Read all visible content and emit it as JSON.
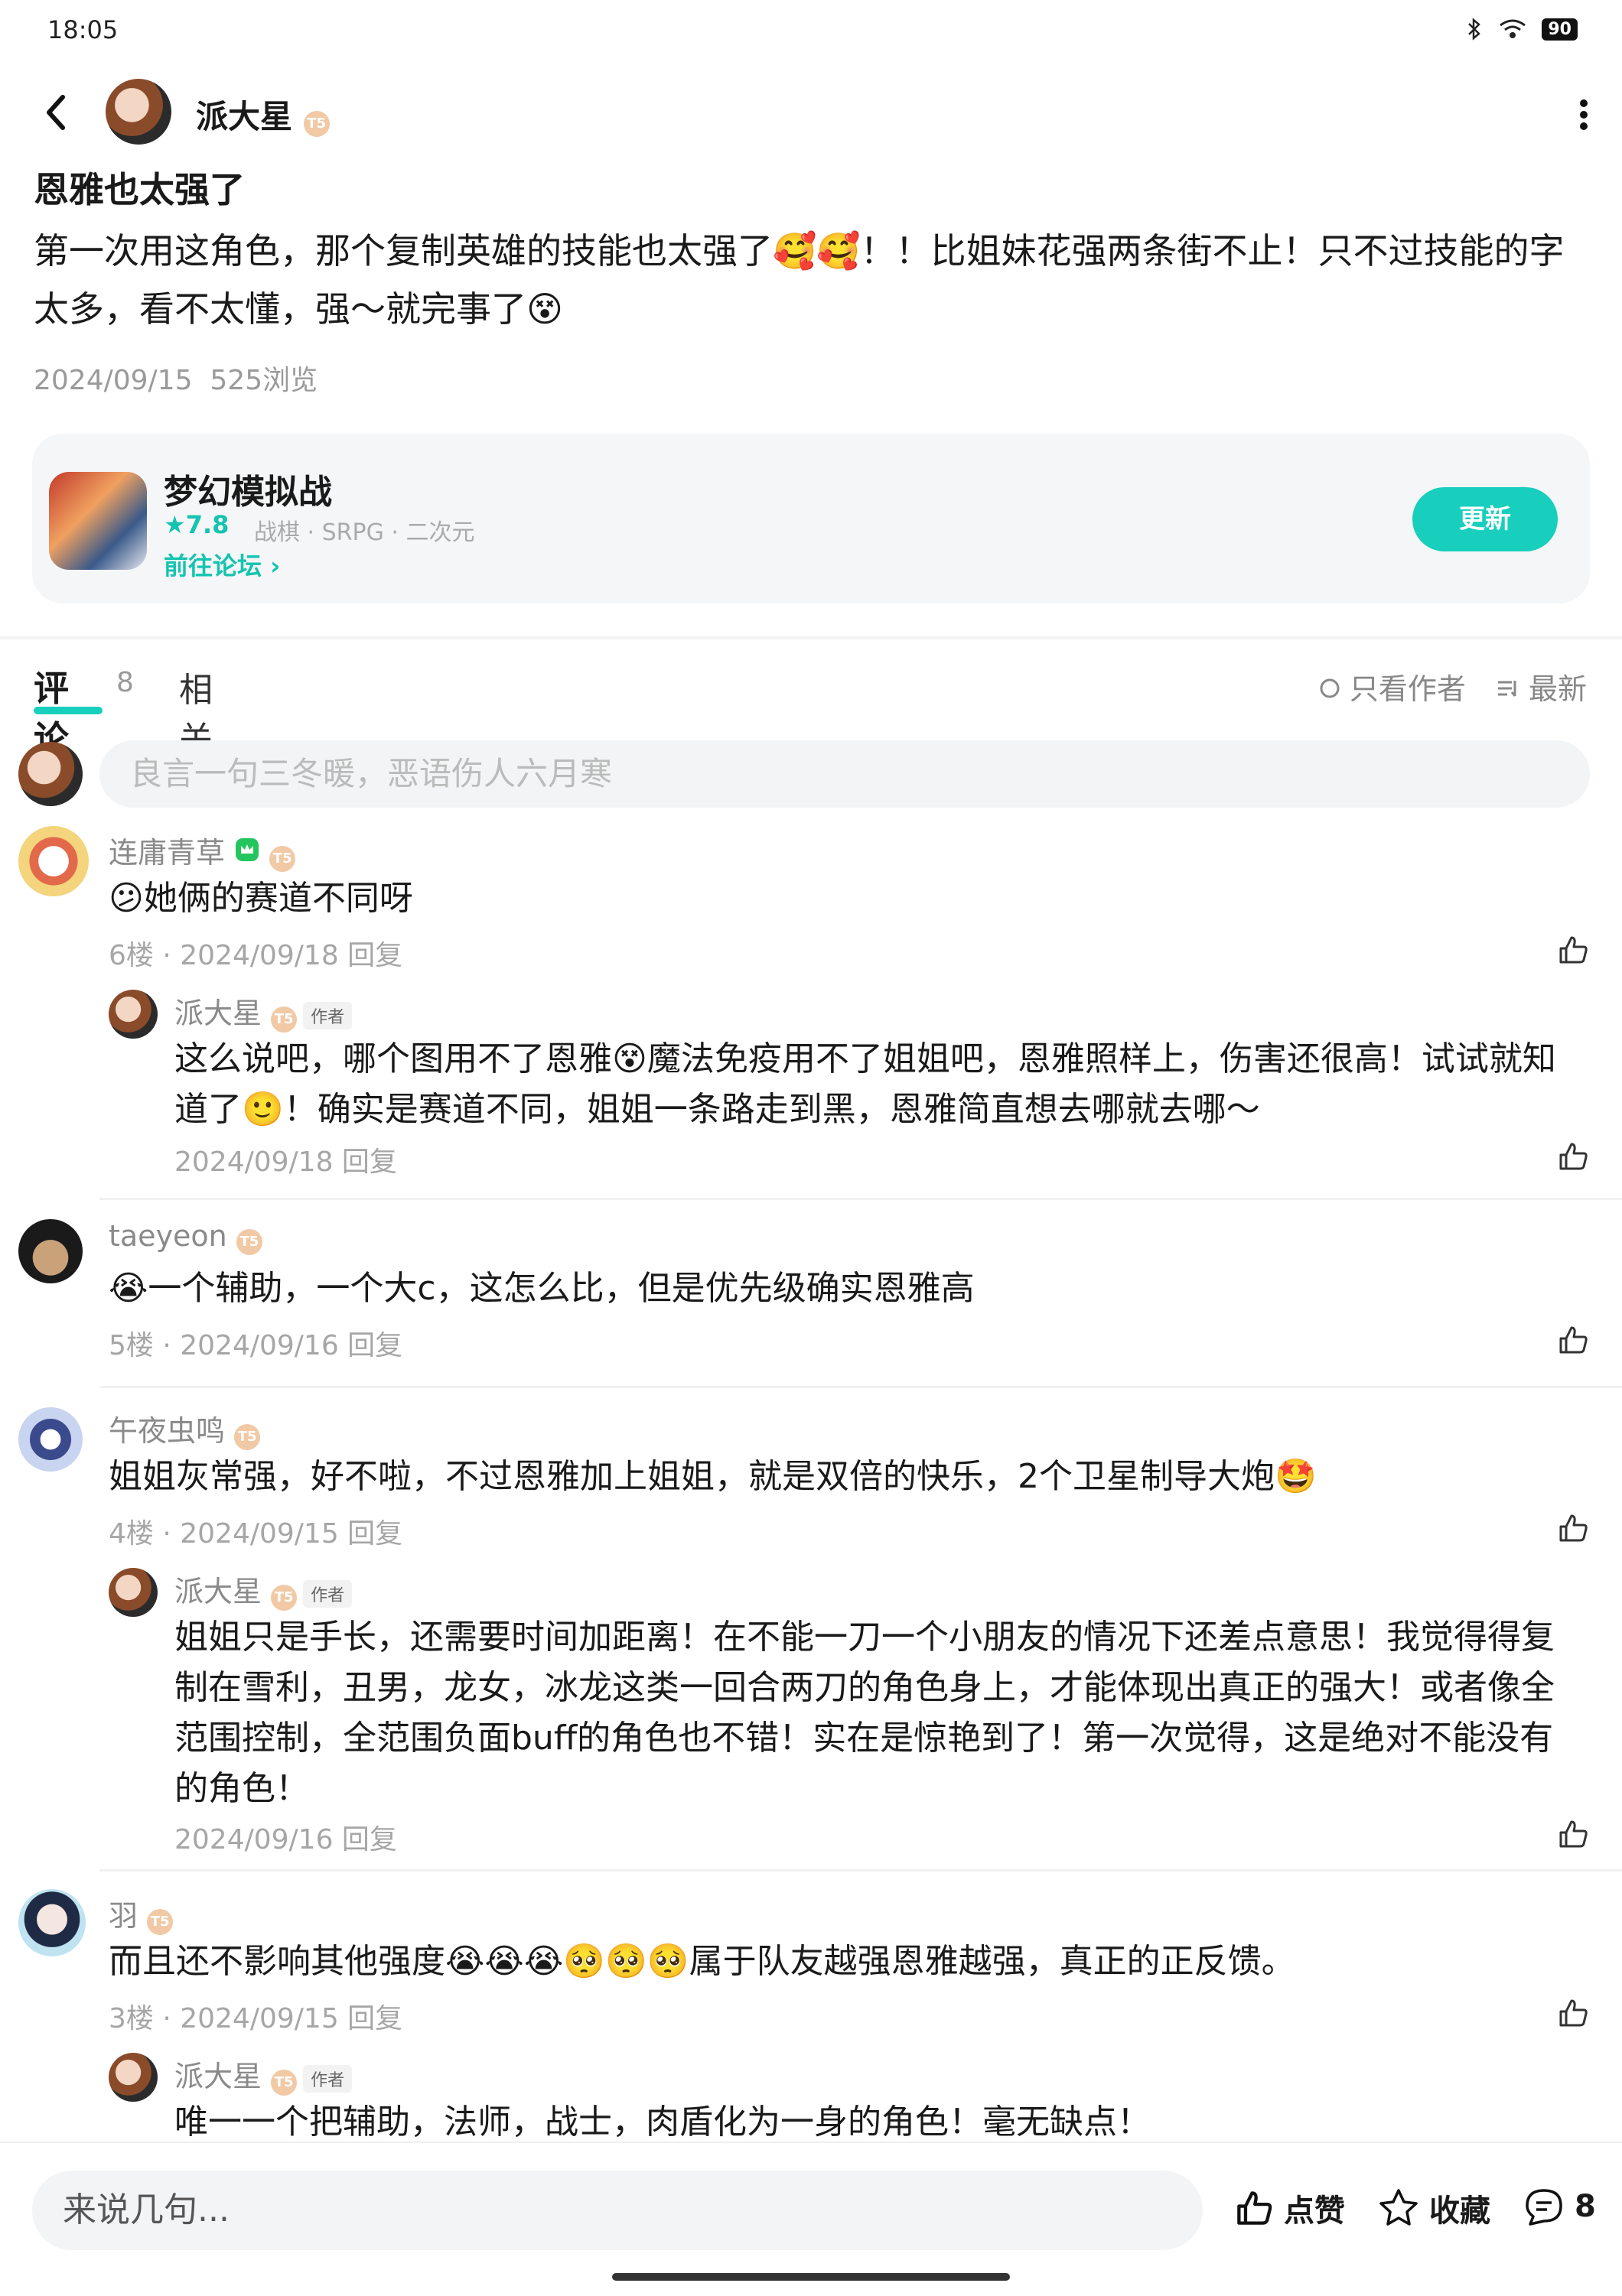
{
  "status_bar": {
    "time": "18:05",
    "battery": "90"
  },
  "header": {
    "author_name": "派大星",
    "level_badge": "T5"
  },
  "post": {
    "title": "恩雅也太强了",
    "body": "第一次用这角色，那个复制英雄的技能也太强了🥰🥰！！比姐妹花强两条街不止！只不过技能的字太多，看不太懂，强～就完事了😵",
    "date": "2024/09/15",
    "views": "525浏览"
  },
  "game_card": {
    "name": "梦幻模拟战",
    "rating": "★7.8",
    "tags": "战棋 · SRPG · 二次元",
    "forum_link": "前往论坛 ›",
    "button": "更新"
  },
  "tabs": {
    "comments": "评论",
    "comment_count": "8",
    "related": "相关",
    "author_only": "只看作者",
    "sort": "最新"
  },
  "reply_placeholder": "良言一句三冬暖，恶语伤人六月寒",
  "comments": [
    {
      "user": "连庸青草",
      "text": "😕她俩的赛道不同呀",
      "meta": "6楼 · 2024/09/18 回复",
      "reply": {
        "user": "派大星",
        "badge": "作者",
        "text": "这么说吧，哪个图用不了恩雅😵魔法免疫用不了姐姐吧，恩雅照样上，伤害还很高！试试就知道了🙂！确实是赛道不同，姐姐一条路走到黑，恩雅简直想去哪就去哪～",
        "meta": "2024/09/18 回复"
      }
    },
    {
      "user": "taeyeon",
      "text": "😭一个辅助，一个大c，这怎么比，但是优先级确实恩雅高",
      "meta": "5楼 · 2024/09/16 回复"
    },
    {
      "user": "午夜虫鸣",
      "text": "姐姐灰常强，好不啦，不过恩雅加上姐姐，就是双倍的快乐，2个卫星制导大炮🤩",
      "meta": "4楼 · 2024/09/15 回复",
      "reply": {
        "user": "派大星",
        "badge": "作者",
        "text": "姐姐只是手长，还需要时间加距离！在不能一刀一个小朋友的情况下还差点意思！我觉得得复制在雪利，丑男，龙女，冰龙这类一回合两刀的角色身上，才能体现出真正的强大！或者像全范围控制，全范围负面buff的角色也不错！实在是惊艳到了！第一次觉得，这是绝对不能没有的角色！",
        "meta": "2024/09/16 回复"
      }
    },
    {
      "user": "羽",
      "text": "而且还不影响其他强度😭😭😭🥺🥺🥺属于队友越强恩雅越强，真正的正反馈。",
      "meta": "3楼 · 2024/09/15 回复",
      "reply": {
        "user": "派大星",
        "badge": "作者",
        "text": "唯一一个把辅助，法师，战士，肉盾化为一身的角色！毫无缺点！"
      }
    }
  ],
  "bottom_bar": {
    "input_placeholder": "来说几句...",
    "like": "点赞",
    "favorite": "收藏",
    "comment_count": "8"
  }
}
